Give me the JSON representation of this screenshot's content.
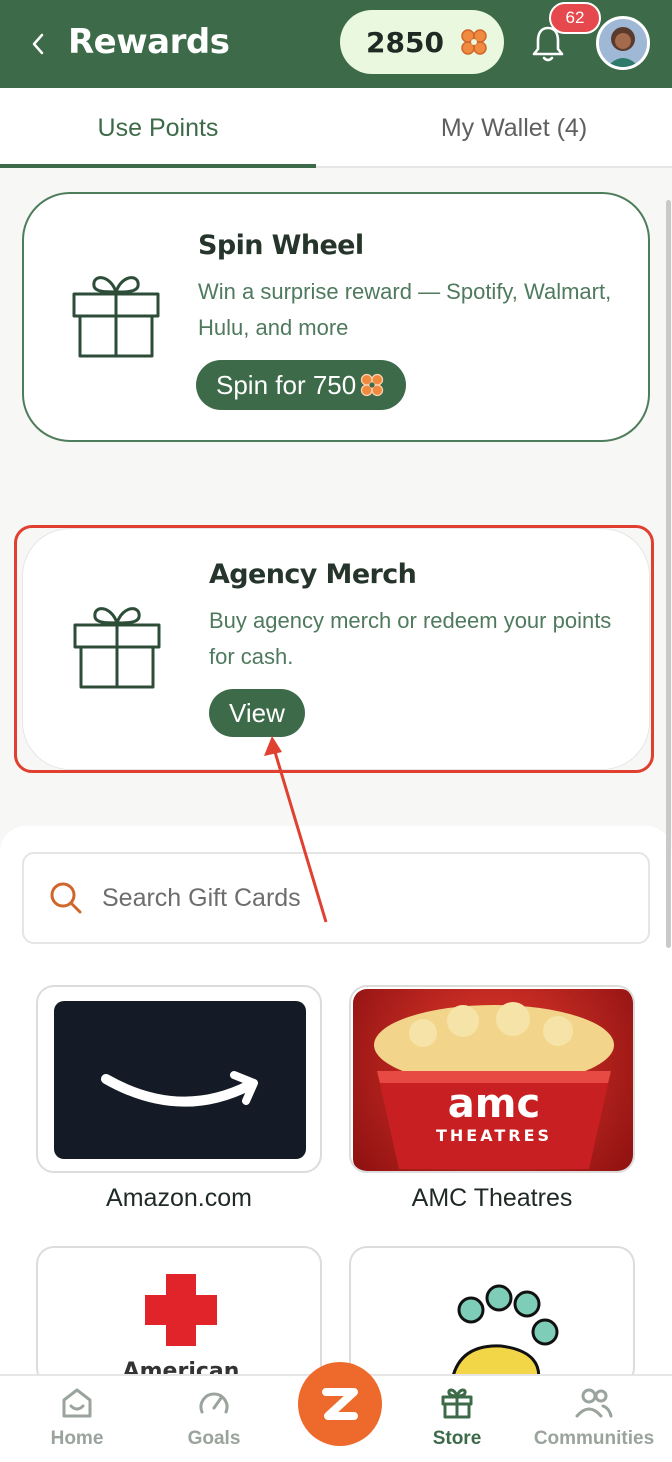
{
  "header": {
    "title": "Rewards",
    "points": "2850",
    "notification_count": "62"
  },
  "tabs": [
    {
      "label": "Use Points",
      "active": true
    },
    {
      "label": "My Wallet (4)",
      "active": false
    }
  ],
  "spin_card": {
    "title": "Spin Wheel",
    "description": "Win a surprise reward — Spotify, Walmart, Hulu, and more",
    "button_label": "Spin for 750"
  },
  "merch_card": {
    "title": "Agency Merch",
    "description": "Buy agency merch or redeem your points for cash.",
    "button_label": "View"
  },
  "search": {
    "placeholder": "Search Gift Cards"
  },
  "gift_cards": [
    {
      "name": "Amazon.com",
      "logo_text": ""
    },
    {
      "name": "AMC Theatres",
      "logo_text": "amc THEATRES"
    },
    {
      "name": "",
      "logo_text": "American"
    },
    {
      "name": "",
      "logo_text": ""
    }
  ],
  "bottom_nav": [
    {
      "label": "Home",
      "icon": "home-icon"
    },
    {
      "label": "Goals",
      "icon": "gauge-icon"
    },
    {
      "label": "Store",
      "icon": "gift-icon",
      "active": true
    },
    {
      "label": "Communities",
      "icon": "people-icon"
    }
  ],
  "colors": {
    "primary_green": "#3d6b4a",
    "points_pill": "#e9f8df",
    "badge_red": "#e5484d",
    "accent_orange": "#ee6a2c",
    "highlight_red": "#e0402f"
  }
}
